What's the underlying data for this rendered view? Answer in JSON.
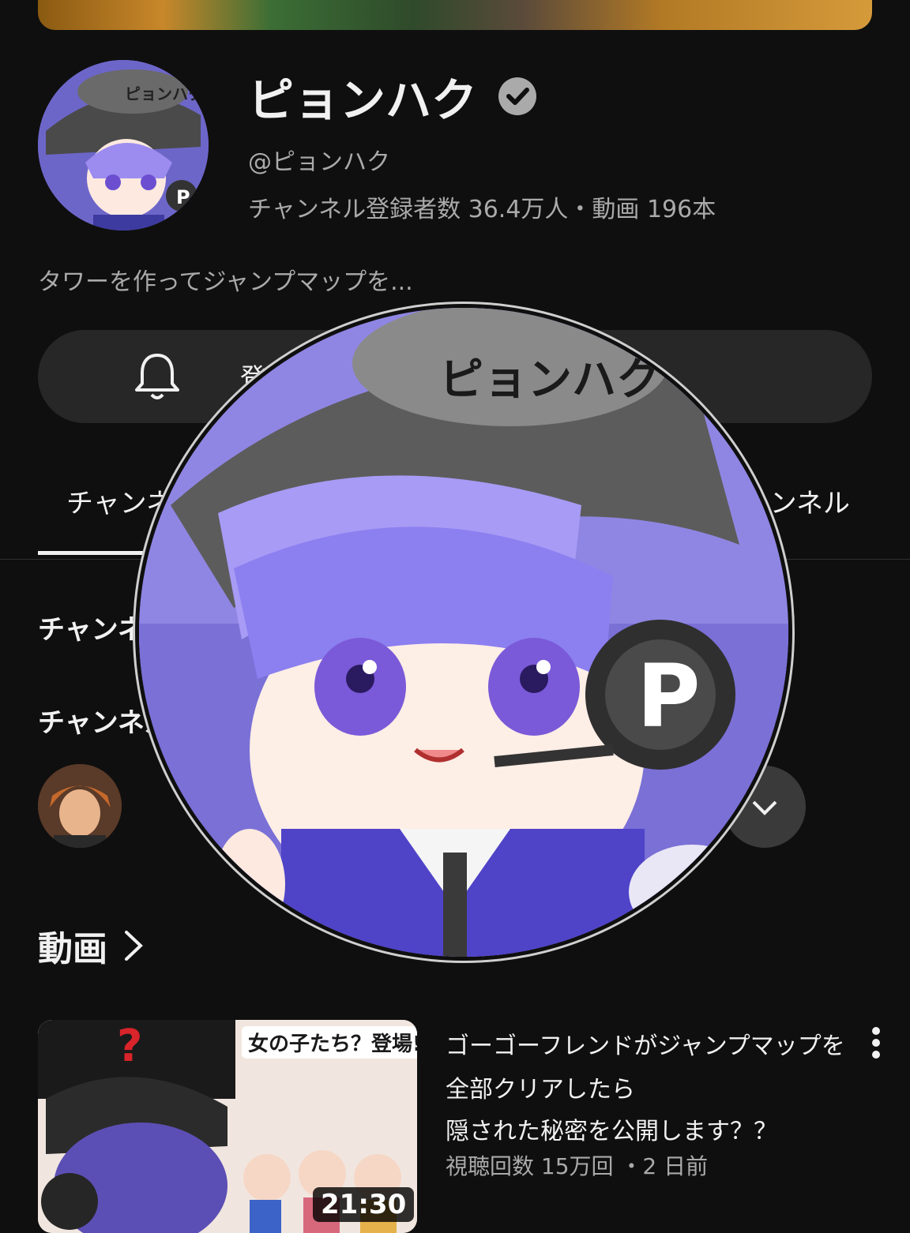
{
  "channel": {
    "name": "ピョンハク",
    "handle": "@ピョンハク",
    "stats": "チャンネル登録者数 36.4万人・動画 196本",
    "description": "タワーを作ってジャンプマップを...",
    "avatar_text": "ピョンハク",
    "headset_letter": "P"
  },
  "subscribe": {
    "label": "登録済み",
    "icon": "bell-icon"
  },
  "tabs": {
    "home": "チャンネル",
    "channels": "チャンネル"
  },
  "rows": {
    "row1": "チャンネル",
    "row2": "チャンネル"
  },
  "videos_section": {
    "title": "動画"
  },
  "video": {
    "title_line1": "ゴーゴーフレンドがジャンプマップを",
    "title_line2": "全部クリアしたら",
    "title_line3": "隠された秘密を公開します？？",
    "meta": "視聴回数 15万回 ・2 日前",
    "duration": "21:30",
    "thumb_caption": "女の子たち？登場!",
    "question_mark": "?"
  },
  "colors": {
    "background": "#0f0f0f",
    "text_primary": "#f1f1f1",
    "text_secondary": "#aaaaaa",
    "avatar_purple": "#8175d8"
  }
}
